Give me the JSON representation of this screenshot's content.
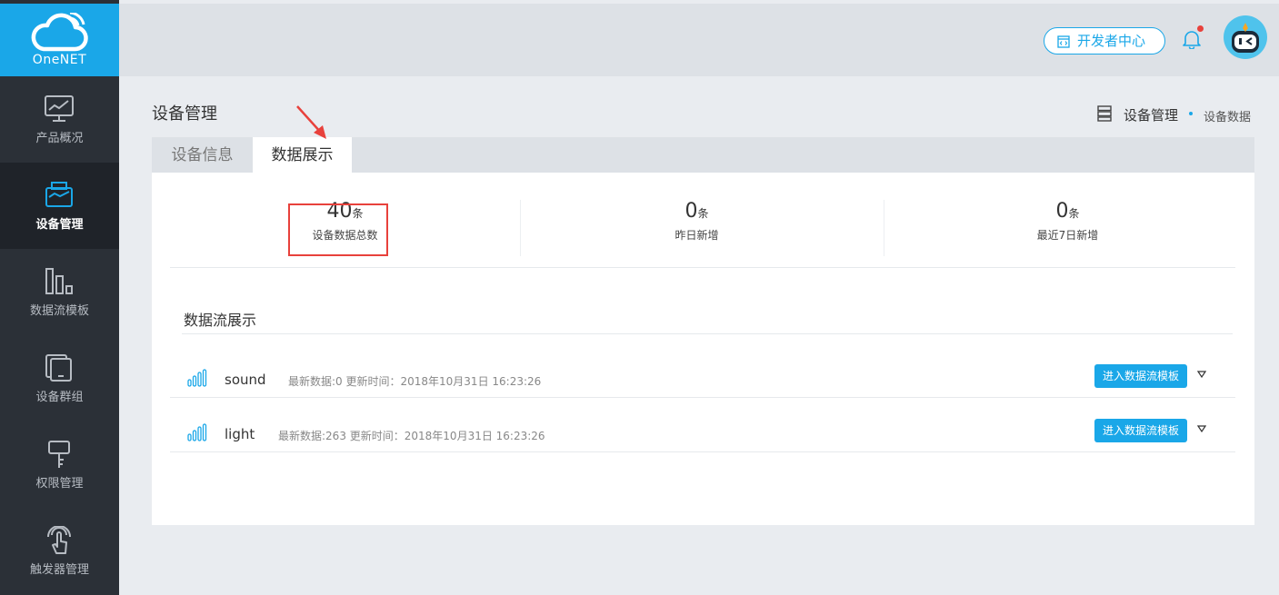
{
  "app": {
    "brand": "OneNET"
  },
  "sidebar": {
    "items": [
      {
        "label": "产品概况",
        "icon": "monitor-chart-icon",
        "active": false
      },
      {
        "label": "设备管理",
        "icon": "device-box-icon",
        "active": true
      },
      {
        "label": "数据流模板",
        "icon": "bar-template-icon",
        "active": false
      },
      {
        "label": "设备群组",
        "icon": "tablet-stack-icon",
        "active": false
      },
      {
        "label": "权限管理",
        "icon": "key-icon",
        "active": false
      },
      {
        "label": "触发器管理",
        "icon": "touch-hand-icon",
        "active": false
      }
    ]
  },
  "header": {
    "dev_center_label": "开发者中心",
    "has_notification": true
  },
  "page": {
    "title": "设备管理",
    "breadcrumb": {
      "parent": "设备管理",
      "current": "设备数据"
    }
  },
  "tabs": [
    {
      "label": "设备信息",
      "active": false
    },
    {
      "label": "数据展示",
      "active": true
    }
  ],
  "stats": [
    {
      "value": "40",
      "unit": "条",
      "caption": "设备数据总数",
      "highlighted": true
    },
    {
      "value": "0",
      "unit": "条",
      "caption": "昨日新增",
      "highlighted": false
    },
    {
      "value": "0",
      "unit": "条",
      "caption": "最近7日新增",
      "highlighted": false
    }
  ],
  "datastreams": {
    "title": "数据流展示",
    "rows": [
      {
        "name": "sound",
        "meta": "最新数据:0 更新时间：2018年10月31日 16:23:26",
        "button_label": "进入数据流模板"
      },
      {
        "name": "light",
        "meta": "最新数据:263 更新时间：2018年10月31日 16:23:26",
        "button_label": "进入数据流模板"
      }
    ]
  },
  "colors": {
    "accent": "#1aa7e8",
    "sidebar_bg": "#2b3037",
    "sidebar_active_bg": "#1f2329",
    "highlight_red": "#e8413c"
  }
}
